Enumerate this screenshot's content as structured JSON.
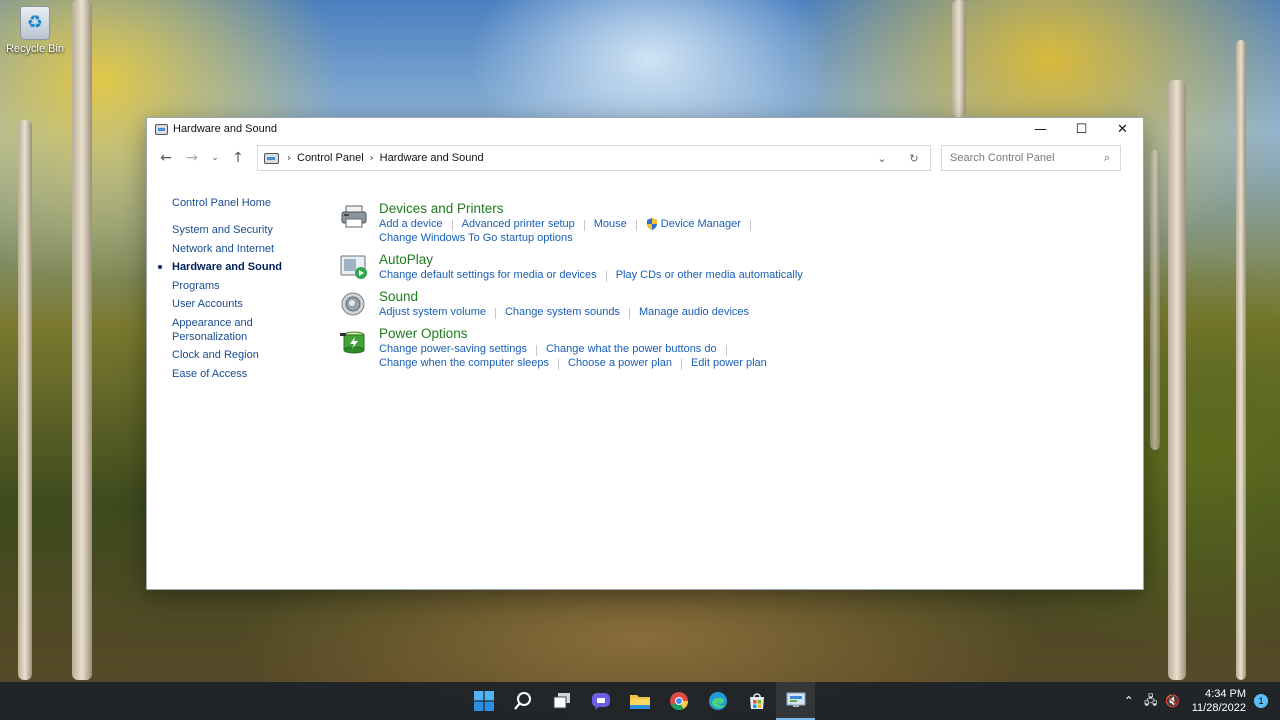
{
  "desktop": {
    "recycle_bin_label": "Recycle Bin"
  },
  "window": {
    "title": "Hardware and Sound",
    "controls": {
      "minimize": "—",
      "maximize": "☐",
      "close": "✕"
    }
  },
  "toolbar": {
    "back": "←",
    "forward": "→",
    "recent": "⌄",
    "up": "↑",
    "breadcrumb": [
      "Control Panel",
      "Hardware and Sound"
    ],
    "separator": "›",
    "dropdown": "⌄",
    "refresh": "↻",
    "search_placeholder": "Search Control Panel",
    "search_icon": "⌕"
  },
  "leftnav": {
    "home": "Control Panel Home",
    "items": [
      {
        "label": "System and Security",
        "current": false
      },
      {
        "label": "Network and Internet",
        "current": false
      },
      {
        "label": "Hardware and Sound",
        "current": true
      },
      {
        "label": "Programs",
        "current": false
      },
      {
        "label": "User Accounts",
        "current": false
      },
      {
        "label": "Appearance and Personalization",
        "current": false
      },
      {
        "label": "Clock and Region",
        "current": false
      },
      {
        "label": "Ease of Access",
        "current": false
      }
    ]
  },
  "categories": [
    {
      "title": "Devices and Printers",
      "icon": "printer-icon",
      "rows": [
        [
          "Add a device",
          "Advanced printer setup",
          "Mouse",
          "Device Manager"
        ],
        [
          "Change Windows To Go startup options"
        ]
      ]
    },
    {
      "title": "AutoPlay",
      "icon": "autoplay-icon",
      "rows": [
        [
          "Change default settings for media or devices",
          "Play CDs or other media automatically"
        ]
      ]
    },
    {
      "title": "Sound",
      "icon": "speaker-icon",
      "rows": [
        [
          "Adjust system volume",
          "Change system sounds",
          "Manage audio devices"
        ]
      ]
    },
    {
      "title": "Power Options",
      "icon": "battery-icon",
      "rows": [
        [
          "Change power-saving settings",
          "Change what the power buttons do"
        ],
        [
          "Change when the computer sleeps",
          "Choose a power plan",
          "Edit power plan"
        ]
      ]
    }
  ],
  "taskbar": {
    "apps": [
      "start-icon",
      "search-icon",
      "task-view-icon",
      "chat-icon",
      "file-explorer-icon",
      "chrome-icon",
      "edge-icon",
      "store-icon",
      "control-panel-icon"
    ],
    "clock_time": "4:34 PM",
    "clock_date": "11/28/2022",
    "notification_count": "1",
    "tray_icons": [
      "chevron-up-icon",
      "network-icon",
      "volume-muted-icon"
    ]
  },
  "colors": {
    "category_title": "#1e7b1e",
    "link": "#1a5fb4",
    "nav_link": "#1a4d8f",
    "taskbar": "#1c2228"
  }
}
